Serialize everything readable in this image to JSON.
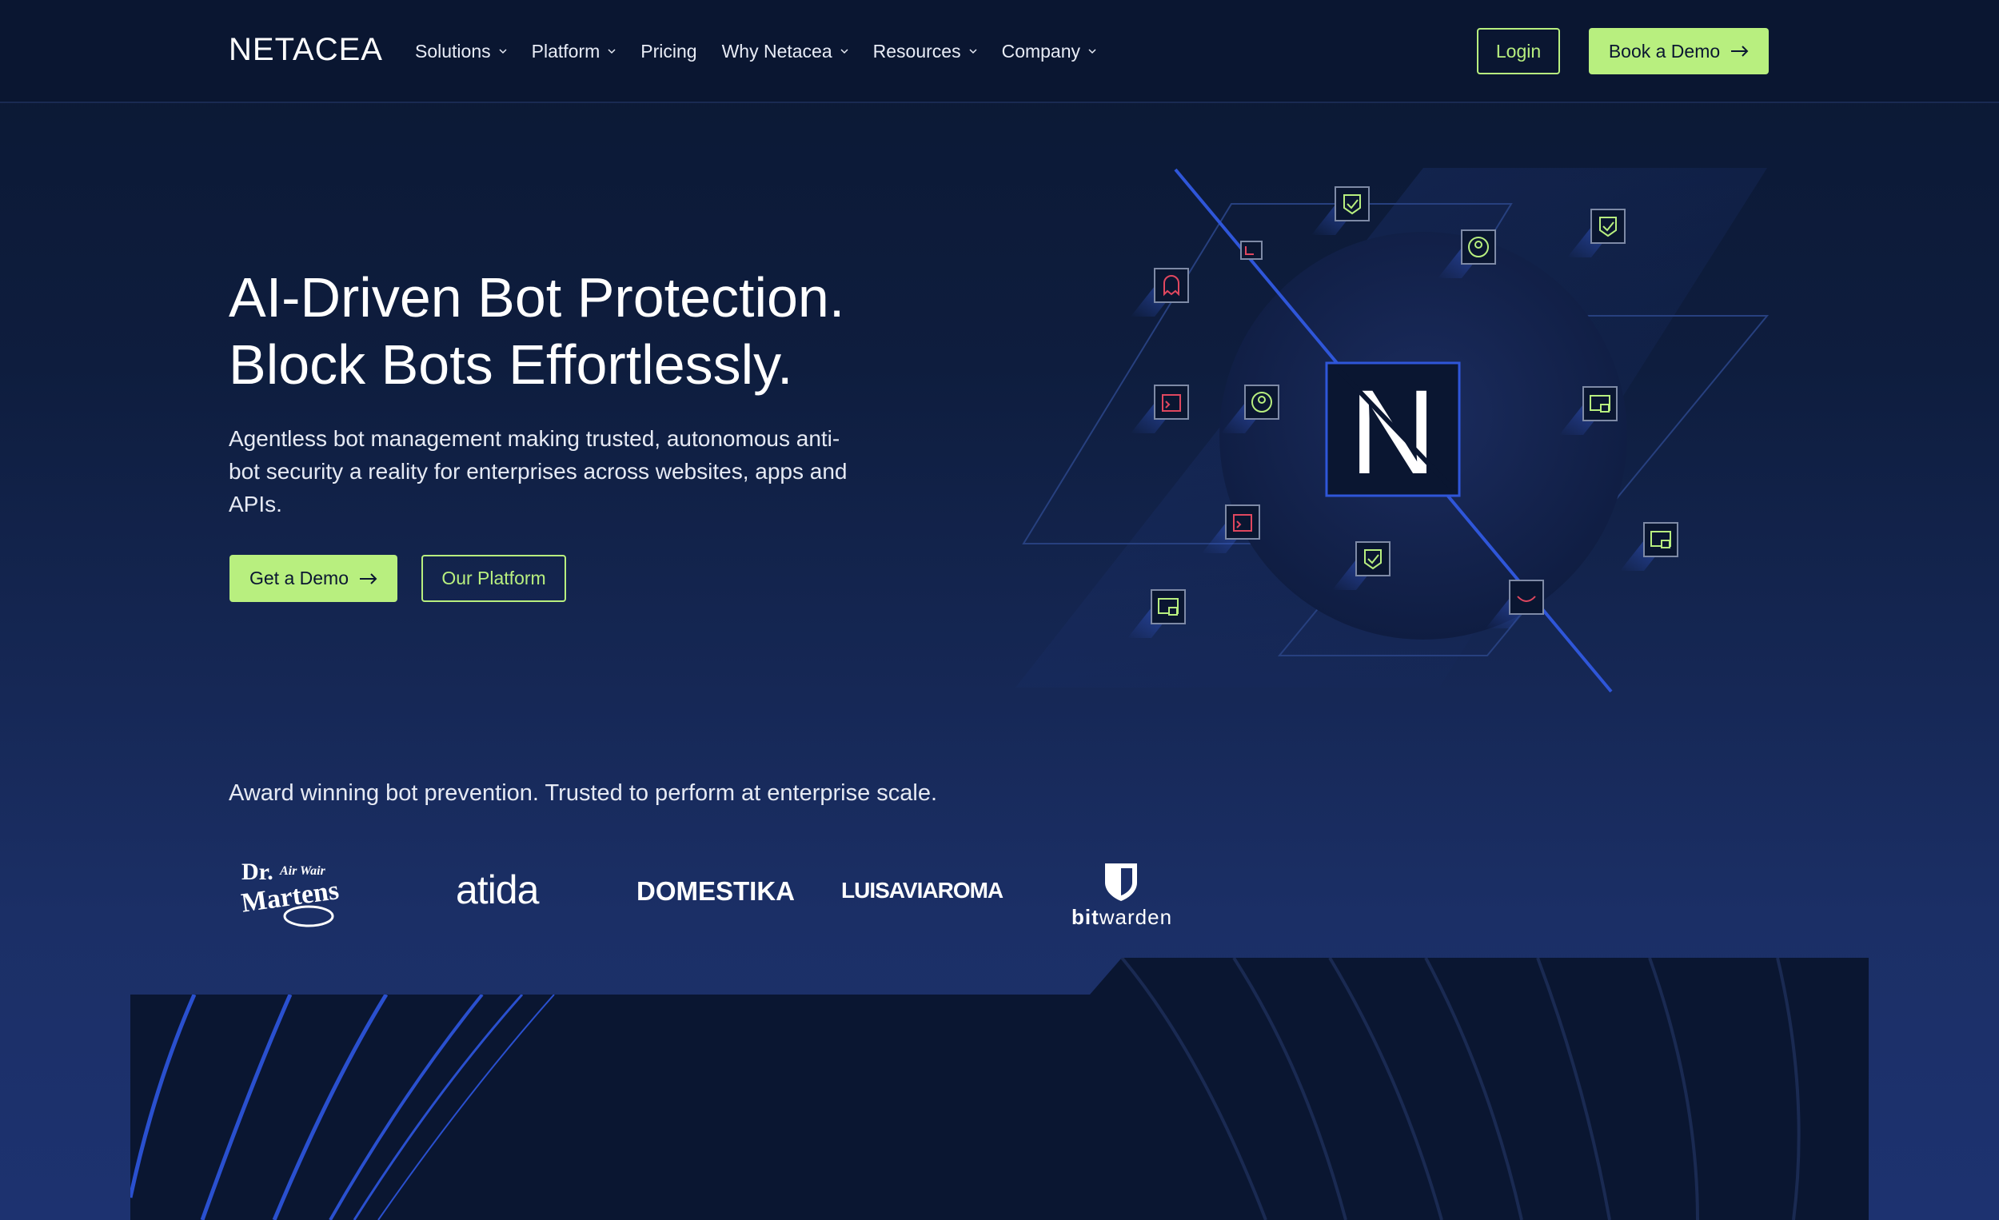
{
  "brand": {
    "logo_text": "NETACEA"
  },
  "nav": {
    "items": [
      {
        "label": "Solutions",
        "dropdown": true
      },
      {
        "label": "Platform",
        "dropdown": true
      },
      {
        "label": "Pricing",
        "dropdown": false
      },
      {
        "label": "Why Netacea",
        "dropdown": true
      },
      {
        "label": "Resources",
        "dropdown": true
      },
      {
        "label": "Company",
        "dropdown": true
      }
    ],
    "login_label": "Login",
    "book_demo_label": "Book a Demo"
  },
  "hero": {
    "title_line1": "AI-Driven Bot Protection.",
    "title_line2": "Block Bots Effortlessly.",
    "subtitle": "Agentless bot management making trusted, autonomous anti-bot security a reality for enterprises across websites, apps and APIs.",
    "primary_cta": "Get a Demo",
    "secondary_cta": "Our Platform",
    "emblem_letter": "N"
  },
  "trusted": {
    "heading": "Award winning bot prevention. Trusted to perform at enterprise scale.",
    "logos": [
      {
        "name": "Dr. Martens",
        "text_top": "Dr.",
        "text_mid": "Air Wair",
        "text_main": "Martens"
      },
      {
        "name": "atida",
        "text_main": "atida"
      },
      {
        "name": "Domestika",
        "text_main": "DOMESTIKA"
      },
      {
        "name": "LuisaViaRoma",
        "text_main": "LUISAVIAROMA"
      },
      {
        "name": "bitwarden",
        "text_bold": "bit",
        "text_rest": "warden"
      }
    ]
  },
  "colors": {
    "accent": "#b8ef7f",
    "background": "#0b1833",
    "header": "#0a1631",
    "line_blue": "#2f56d9",
    "icon_red": "#e0475f"
  }
}
